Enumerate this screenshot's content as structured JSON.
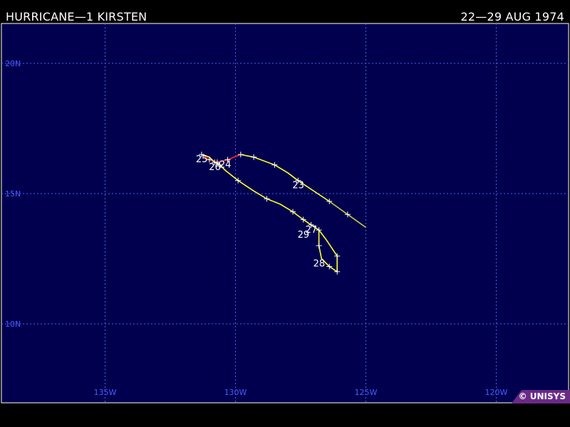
{
  "header": {
    "storm_title": "HURRICANE—1 KIRSTEN",
    "date_range": "22—29 AUG 1974"
  },
  "credit": "© UNISYS",
  "colors": {
    "ocean": "#00004e",
    "grid": "#4a5bff",
    "track_hurricane": "#ffff30",
    "track_storm": "#c8c840",
    "track_depression": "#ff2a2a"
  },
  "map": {
    "lon_range": [
      -136,
      -120
    ],
    "lat_range": [
      7,
      22
    ],
    "lat_labels": [
      {
        "lat": 20,
        "label": "20N"
      },
      {
        "lat": 15,
        "label": "15N"
      },
      {
        "lat": 10,
        "label": "10N"
      }
    ],
    "lon_labels": [
      {
        "lon": -135,
        "label": "135W"
      },
      {
        "lon": -130,
        "label": "130W"
      },
      {
        "lon": -125,
        "label": "125W"
      },
      {
        "lon": -120,
        "label": "120W"
      }
    ]
  },
  "track": {
    "segments": [
      {
        "intensity": "storm",
        "points": [
          [
            -125.0,
            13.7
          ],
          [
            -125.7,
            14.2
          ],
          [
            -126.4,
            14.7
          ]
        ]
      },
      {
        "intensity": "hurricane",
        "points": [
          [
            -126.4,
            14.7
          ],
          [
            -127.6,
            15.5
          ],
          [
            -128.0,
            15.8
          ],
          [
            -128.5,
            16.1
          ],
          [
            -129.3,
            16.4
          ],
          [
            -129.8,
            16.5
          ]
        ]
      },
      {
        "intensity": "depression",
        "points": [
          [
            -129.8,
            16.5
          ],
          [
            -130.3,
            16.3
          ],
          [
            -130.7,
            16.2
          ],
          [
            -131.0,
            16.3
          ],
          [
            -131.3,
            16.5
          ]
        ]
      },
      {
        "intensity": "hurricane",
        "points": [
          [
            -131.3,
            16.5
          ],
          [
            -131.0,
            16.4
          ],
          [
            -130.8,
            16.2
          ],
          [
            -130.6,
            16.1
          ],
          [
            -130.4,
            15.9
          ],
          [
            -129.9,
            15.5
          ],
          [
            -129.3,
            15.1
          ],
          [
            -128.8,
            14.8
          ],
          [
            -128.3,
            14.6
          ],
          [
            -127.8,
            14.3
          ],
          [
            -127.4,
            14.0
          ],
          [
            -127.1,
            13.8
          ],
          [
            -126.8,
            13.6
          ],
          [
            -126.5,
            13.2
          ],
          [
            -126.1,
            12.6
          ],
          [
            -126.1,
            12.0
          ],
          [
            -126.4,
            12.2
          ],
          [
            -126.7,
            12.5
          ],
          [
            -126.8,
            13.0
          ],
          [
            -126.8,
            13.6
          ]
        ]
      }
    ],
    "markers": [
      [
        -125.7,
        14.2
      ],
      [
        -126.4,
        14.7
      ],
      [
        -127.6,
        15.5
      ],
      [
        -128.5,
        16.1
      ],
      [
        -129.3,
        16.4
      ],
      [
        -129.8,
        16.5
      ],
      [
        -130.3,
        16.3
      ],
      [
        -130.7,
        16.2
      ],
      [
        -131.0,
        16.3
      ],
      [
        -131.3,
        16.5
      ],
      [
        -130.8,
        16.2
      ],
      [
        -130.6,
        16.1
      ],
      [
        -129.9,
        15.5
      ],
      [
        -128.8,
        14.8
      ],
      [
        -127.8,
        14.3
      ],
      [
        -127.4,
        14.0
      ],
      [
        -127.1,
        13.8
      ],
      [
        -126.8,
        13.6
      ],
      [
        -126.1,
        12.6
      ],
      [
        -126.1,
        12.0
      ],
      [
        -126.4,
        12.2
      ],
      [
        -126.8,
        13.0
      ]
    ],
    "day_labels": [
      {
        "text": "23",
        "lon": -127.6,
        "lat": 15.5
      },
      {
        "text": "25",
        "lon": -131.3,
        "lat": 16.5
      },
      {
        "text": "26",
        "lon": -130.8,
        "lat": 16.2
      },
      {
        "text": "24",
        "lon": -130.4,
        "lat": 16.3
      },
      {
        "text": "27",
        "lon": -127.1,
        "lat": 13.8
      },
      {
        "text": "29",
        "lon": -127.4,
        "lat": 13.6
      },
      {
        "text": "28",
        "lon": -126.8,
        "lat": 12.5
      }
    ]
  }
}
